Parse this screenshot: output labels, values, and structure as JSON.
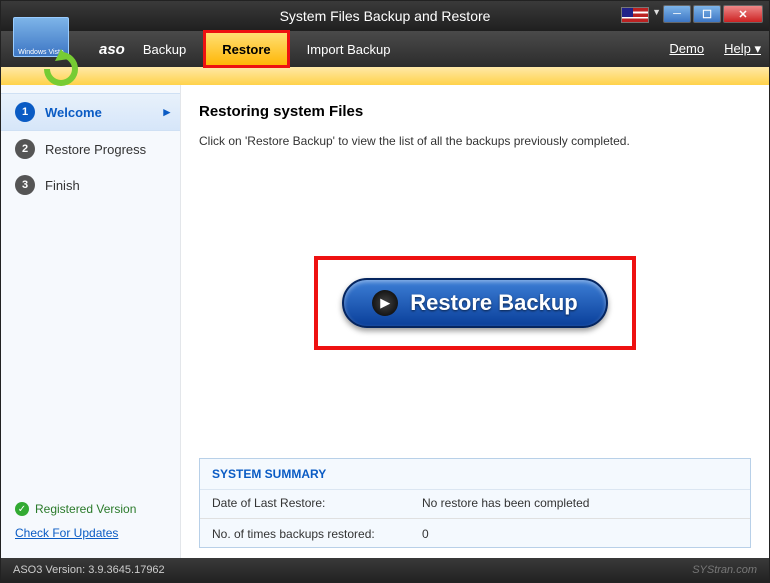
{
  "titlebar": {
    "title": "System Files Backup and Restore"
  },
  "brand": "aso",
  "menu": {
    "backup": "Backup",
    "restore": "Restore",
    "import": "Import Backup",
    "demo": "Demo",
    "help": "Help"
  },
  "sidebar": {
    "steps": [
      {
        "num": "1",
        "label": "Welcome"
      },
      {
        "num": "2",
        "label": "Restore Progress"
      },
      {
        "num": "3",
        "label": "Finish"
      }
    ],
    "registered": "Registered Version",
    "updates": "Check For Updates"
  },
  "main": {
    "heading": "Restoring system Files",
    "instruction": "Click on 'Restore Backup' to view the list of all the backups previously completed.",
    "restore_label": "Restore Backup"
  },
  "summary": {
    "title": "SYSTEM SUMMARY",
    "last_restore_label": "Date of Last Restore:",
    "last_restore_value": "No restore has been completed",
    "times_label": "No. of times backups restored:",
    "times_value": "0"
  },
  "status": {
    "version": "ASO3 Version: 3.9.3645.17962",
    "watermark": "SYStran.com"
  }
}
